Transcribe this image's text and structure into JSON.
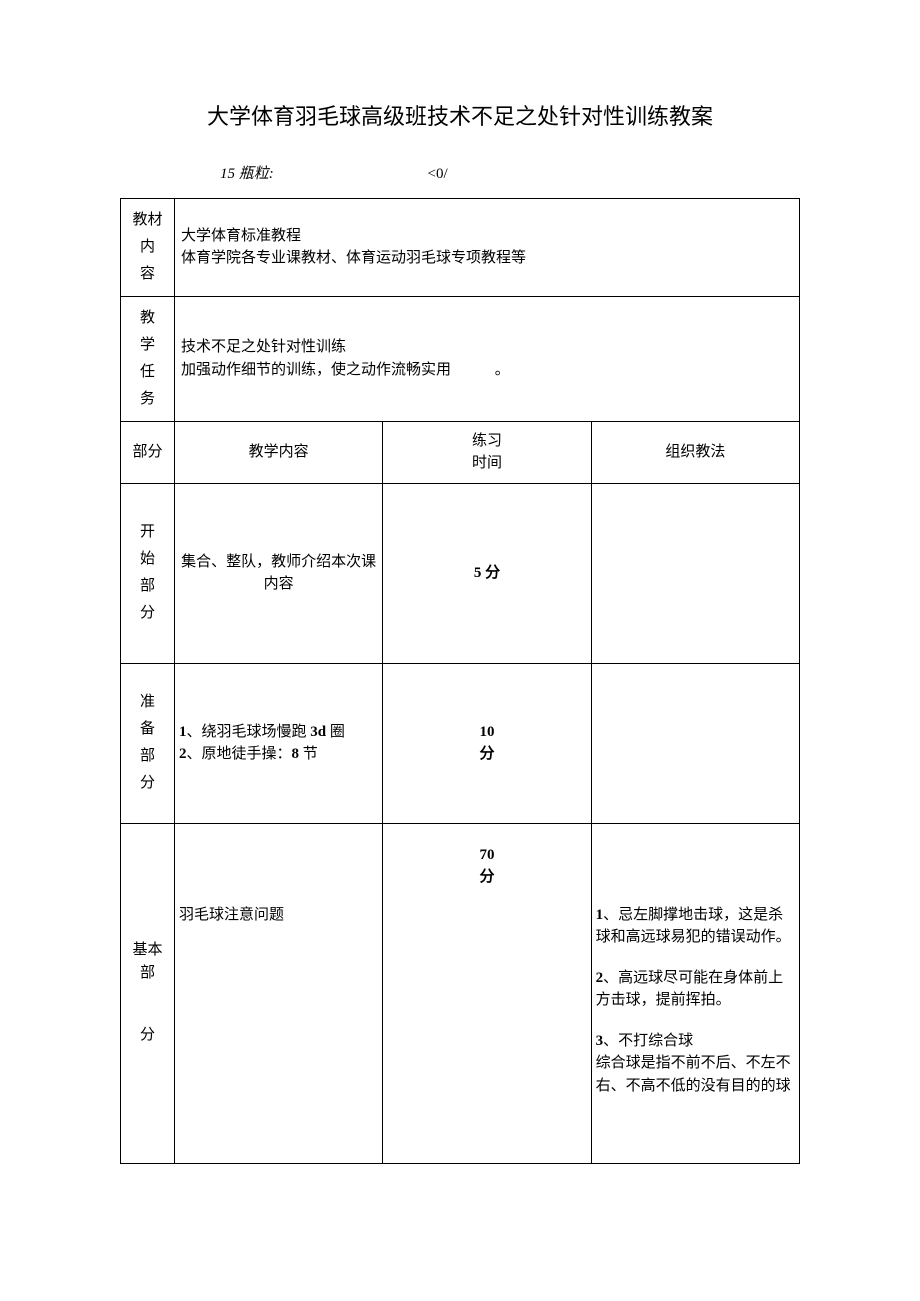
{
  "title": "大学体育羽毛球高级班技术不足之处针对性训练教案",
  "meta": {
    "left": "15 瓶粒:",
    "right": "<0/"
  },
  "rows": {
    "material": {
      "label1": "教材内",
      "label2": "容",
      "content1": "大学体育标准教程",
      "content2": "体育学院各专业课教材、体育运动羽毛球专项教程等"
    },
    "task": {
      "label1": "教",
      "label2": "学",
      "label3": "任",
      "label4": "务",
      "content1": "技术不足之处针对性训练",
      "content2a": "加强动作细节的训练，使之动作流畅实用",
      "content2b": "。"
    },
    "header": {
      "section": "部分",
      "content": "教学内容",
      "time1": "练习",
      "time2": "时间",
      "method": "组织教法"
    },
    "start": {
      "label1": "开",
      "label2": "始",
      "label3": "部",
      "label4": "分",
      "content": "集合、整队，教师介绍本次课内容",
      "time": "5 分"
    },
    "prep": {
      "label1": "准",
      "label2": "备",
      "label3": "部",
      "label4": "分",
      "line1a": "1",
      "line1b": "、绕羽毛球场慢跑 ",
      "line1c": "3d ",
      "line1d": "圈",
      "line2a": "2",
      "line2b": "、原地徒手操：",
      "line2c": "8 ",
      "line2d": "节",
      "time1": "10",
      "time2": "分"
    },
    "base": {
      "label1": "基本部",
      "label2": "分",
      "content": "羽毛球注意问题",
      "time1": "70",
      "time2": "分",
      "p1a": "1",
      "p1b": "、忌左脚撑地击球，这是杀球和高远球易犯的错误动作。",
      "p2a": "2",
      "p2b": "、高远球尽可能在身体前上方击球，提前挥拍。",
      "p3a": "3",
      "p3b": "、不打综合球",
      "p3c": "综合球是指不前不后、不左不右、不高不低的没有目的的球"
    }
  }
}
